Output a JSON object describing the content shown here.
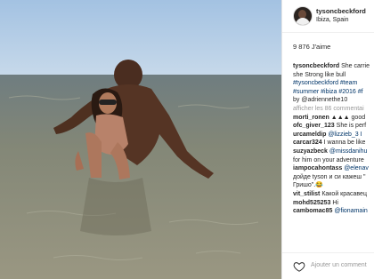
{
  "post": {
    "username": "tysoncbeckford",
    "location": "Ibiza, Spain",
    "likes": "9 876 J'aime",
    "caption_user": "tysoncbeckford",
    "caption_lines": [
      "She carrie",
      "she Strong like bull",
      "#tysoncbeckford #team",
      "#summer #ibiza #2016 #f",
      "by @adriennethe10"
    ],
    "more_comments": "afficher les 86 commentai",
    "comments": [
      {
        "user": "morti_ronen",
        "text": "▲▲▲ good"
      },
      {
        "user": "ofc_giver_123",
        "text": "She is perf"
      },
      {
        "user": "urcameldip",
        "text": "@lizzieb_3 I"
      },
      {
        "user": "carcar324",
        "text": "I wanna be like"
      },
      {
        "user": "suzyazbeck",
        "text": "@missdanihu",
        "text2": "for him on your adventure"
      },
      {
        "user": "iampocahontass",
        "text": "@elenav",
        "text2": "дойде tyson и си кажеш \"",
        "text3": "Гришо\".😂"
      },
      {
        "user": "vit_stilist",
        "text": "Какой красавец"
      },
      {
        "user": "mohd525253",
        "text": "Hi"
      },
      {
        "user": "cambomac85",
        "text": "@fionamain"
      }
    ],
    "add_comment_placeholder": "Ajouter un comment"
  },
  "icons": {
    "heart": "heart-icon",
    "avatar": "avatar"
  },
  "colors": {
    "sky": "#a9c6e4",
    "sea": "#8a8a78",
    "link": "#003569"
  }
}
